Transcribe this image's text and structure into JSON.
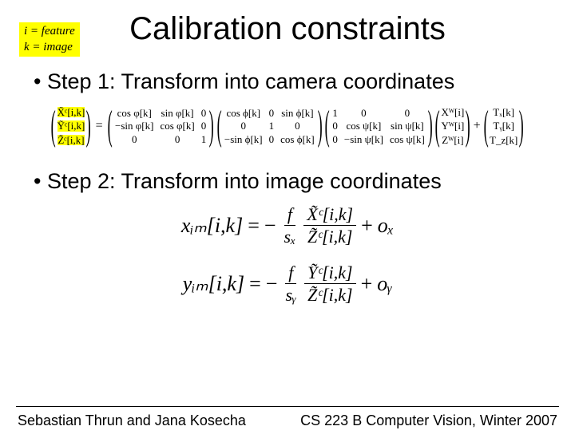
{
  "legend": {
    "line1": "i = feature",
    "line2": "k = image"
  },
  "title": "Calibration constraints",
  "bullets": {
    "step1": "Step 1: Transform into camera coordinates",
    "step2": "Step 2: Transform into image coordinates"
  },
  "eq1": {
    "lhs": [
      "X̃ᶜ[i,k]",
      "Ỹᶜ[i,k]",
      "Z̃ᶜ[i,k]"
    ],
    "equals": "=",
    "Rphi": [
      [
        "cos φ[k]",
        "sin φ[k]",
        "0"
      ],
      [
        "−sin φ[k]",
        "cos φ[k]",
        "0"
      ],
      [
        "0",
        "0",
        "1"
      ]
    ],
    "Rtheta": [
      [
        "cos ϕ[k]",
        "0",
        "sin ϕ[k]"
      ],
      [
        "0",
        "1",
        "0"
      ],
      [
        "−sin ϕ[k]",
        "0",
        "cos ϕ[k]"
      ]
    ],
    "Rpsi": [
      [
        "1",
        "0",
        "0"
      ],
      [
        "0",
        "cos ψ[k]",
        "sin ψ[k]"
      ],
      [
        "0",
        "−sin ψ[k]",
        "cos ψ[k]"
      ]
    ],
    "Xw": [
      "Xᵂ[i]",
      "Yᵂ[i]",
      "Zᵂ[i]"
    ],
    "plus": "+",
    "T": [
      "Tₓ[k]",
      "Tᵧ[k]",
      "T_z[k]"
    ]
  },
  "eq2": {
    "x": {
      "lhs": "xᵢₘ[i,k]",
      "eq": "=",
      "neg": "−",
      "f": "f",
      "sx": "sₓ",
      "num": "X̃ᶜ[i,k]",
      "den": "Z̃ᶜ[i,k]",
      "plus": "+",
      "ox": "oₓ"
    },
    "y": {
      "lhs": "yᵢₘ[i,k]",
      "eq": "=",
      "neg": "−",
      "f": "f",
      "sy": "sᵧ",
      "num": "Ỹᶜ[i,k]",
      "den": "Z̃ᶜ[i,k]",
      "plus": "+",
      "oy": "oᵧ"
    }
  },
  "footer": {
    "left": "Sebastian Thrun and Jana Kosecha",
    "right": "CS 223 B Computer Vision, Winter 2007"
  }
}
